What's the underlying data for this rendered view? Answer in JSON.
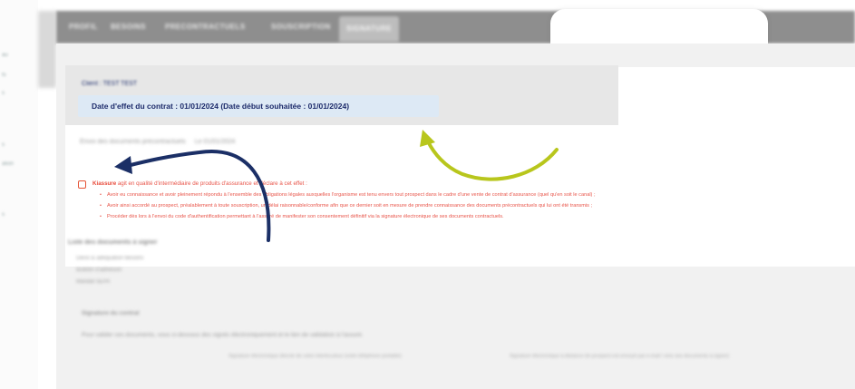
{
  "sidebar": {
    "fragments": [
      "au",
      "ts",
      "s",
      "s",
      "ation",
      "s"
    ]
  },
  "nav": {
    "tabs": [
      "PROFIL",
      "BESOINS",
      "PRECONTRACTUELS",
      "SOUSCRIPTION",
      "SIGNATURE"
    ],
    "active_index": 4
  },
  "client": {
    "title": "Client : TEST TEST",
    "date_text": "Date d'effet du contrat : 01/01/2024 (Date début souhaitée : 01/01/2024)"
  },
  "envoi": {
    "text": "Envoi des documents précontractuels",
    "action": "Le 01/01/2024"
  },
  "consent": {
    "company": "Kiassure",
    "intro": " agit en qualité d'intermédiaire de produits d'assurance et déclare à cet effet :",
    "bullets": [
      "Avoir eu connaissance et avoir pleinement répondu à l'ensemble des obligations légales auxquelles l'organisme est tenu envers tout prospect dans le cadre d'une vente de contrat d'assurance (quel qu'en soit le canal) ;",
      "Avoir ainsi accordé au prospect, préalablement à toute souscription, un délai raisonnable/conforme afin que ce dernier soit en mesure de prendre connaissance des documents précontractuels qui lui ont été transmis ;",
      "Procéder dès lors à l'envoi du code d'authentification permettant à l'assuré de manifester son consentement définitif via la signature électronique de ses documents contractuels."
    ]
  },
  "documents": {
    "title": "Liste des documents à signer",
    "items": [
      "Devis & adéquation besoins",
      "Bulletin d'adhésion",
      "Mandat SEPA"
    ]
  },
  "signature": {
    "title": "Signature du contrat",
    "text": "Pour valider ces documents, vous ci-dessous des signés électroniquement et le lien de validation à l'assuré.",
    "option1": "Signature électronique directe de votre interlocuteur (votre téléphone portable)",
    "option2": "Signature électronique à distance (le prospect est envoyé par e-mail / sms ses documents à signer)"
  },
  "colors": {
    "navy_arrow": "#1b2f66",
    "lime_arrow": "#b8c61c",
    "consent_red": "#e8554a",
    "date_box": "#dde9f5"
  }
}
